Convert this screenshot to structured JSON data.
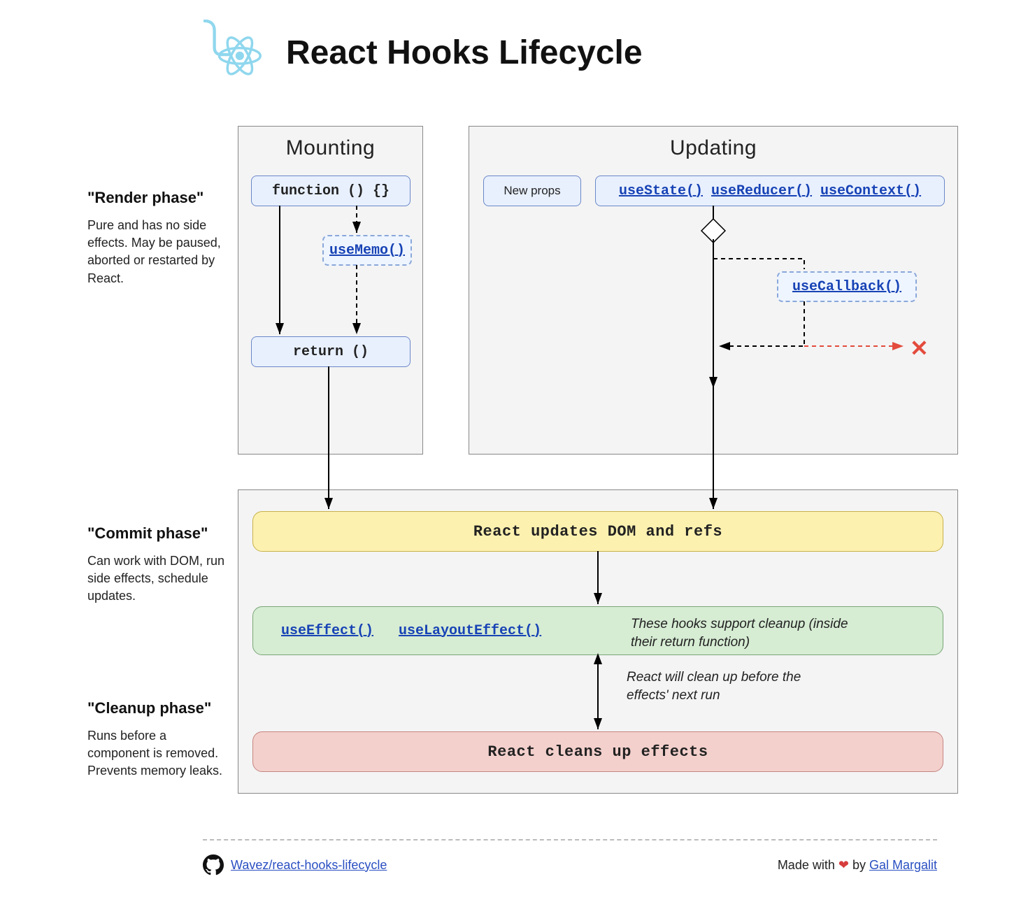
{
  "title": "React Hooks Lifecycle",
  "phases": {
    "render": {
      "title": "\"Render phase\"",
      "desc": "Pure and has no side effects. May be paused, aborted or restarted by React."
    },
    "commit": {
      "title": "\"Commit phase\"",
      "desc": "Can work with DOM, run side effects, schedule updates."
    },
    "cleanup": {
      "title": "\"Cleanup phase\"",
      "desc": "Runs before a component is removed. Prevents memory leaks."
    }
  },
  "mounting": {
    "title": "Mounting",
    "fn": "function () {}",
    "useMemo": "useMemo()",
    "ret": "return ()"
  },
  "updating": {
    "title": "Updating",
    "newProps": "New props",
    "useState": "useState()",
    "useReducer": "useReducer()",
    "useContext": "useContext()",
    "useCallback": "useCallback()"
  },
  "commit": {
    "domUpdate": "React updates DOM and refs",
    "useEffect": "useEffect()",
    "useLayoutEffect": "useLayoutEffect()",
    "cleanupNote": "These hooks support cleanup (inside their return function)",
    "betweenNote": "React will clean up before the effects' next run",
    "cleanupLine": "React cleans up effects"
  },
  "footer": {
    "repo": "Wavez/react-hooks-lifecycle",
    "madePrefix": "Made with ",
    "madeBy": " by ",
    "author": "Gal Margalit"
  }
}
